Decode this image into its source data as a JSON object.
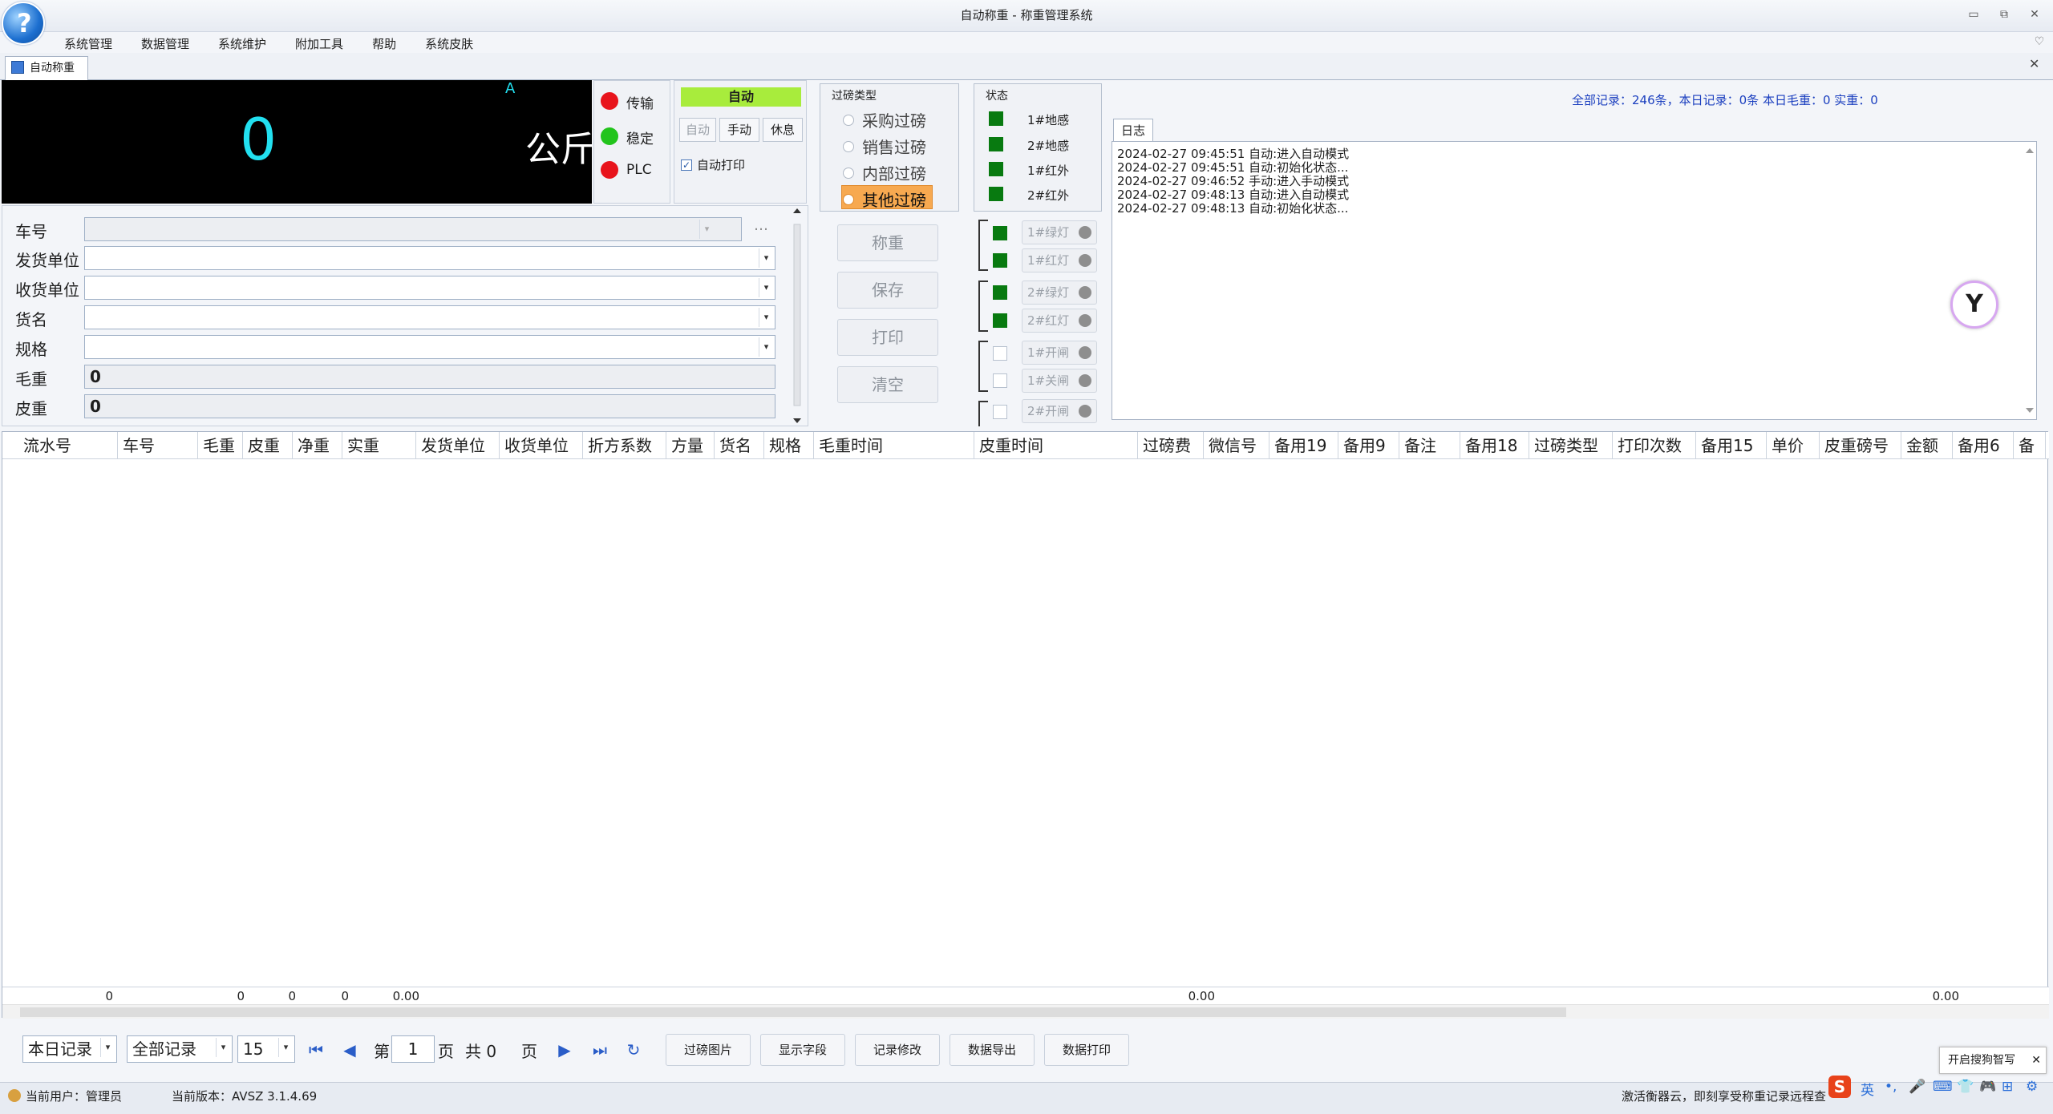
{
  "window": {
    "title": "自动称重 - 称重管理系统",
    "min": "▭",
    "restore": "⧉",
    "close": "✕",
    "collapse": "♡"
  },
  "menu": [
    "系统管理",
    "数据管理",
    "系统维护",
    "附加工具",
    "帮助",
    "系统皮肤"
  ],
  "tab": {
    "label": "自动称重",
    "close": "✕"
  },
  "display": {
    "weight": "0",
    "unit": "公斤",
    "mark": "A"
  },
  "lights": [
    {
      "label": "传输",
      "color": "#e8141c"
    },
    {
      "label": "稳定",
      "color": "#22c41c"
    },
    {
      "label": "PLC",
      "color": "#e8141c"
    }
  ],
  "mode": {
    "badge": "自动",
    "buttons": [
      "自动",
      "手动",
      "休息"
    ],
    "autoprint": "自动打印",
    "check": "✓"
  },
  "form": {
    "labels": [
      "车号",
      "发货单位",
      "收货单位",
      "货名",
      "规格",
      "毛重",
      "皮重"
    ],
    "gross": "0",
    "tare": "0",
    "ellipsis": "…",
    "arrow": "▾"
  },
  "filter": {
    "title": "过磅类型",
    "options": [
      "采购过磅",
      "销售过磅",
      "内部过磅",
      "其他过磅"
    ],
    "selected": "其他过磅"
  },
  "state": {
    "title": "状态",
    "items": [
      "1#地感",
      "2#地感",
      "1#红外",
      "2#红外"
    ]
  },
  "actions": [
    "称重",
    "保存",
    "打印",
    "清空"
  ],
  "controls": [
    "1#绿灯",
    "1#红灯",
    "2#绿灯",
    "2#红灯",
    "1#开闸",
    "1#关闸",
    "2#开闸"
  ],
  "log": {
    "stats": "全部记录：246条，本日记录：0条 本日毛重：0 实重：0",
    "tab": "日志",
    "lines": [
      "2024-02-27 09:45:51 自动:进入自动模式",
      "2024-02-27 09:45:51 自动:初始化状态...",
      "2024-02-27 09:46:52 手动:进入手动模式",
      "2024-02-27 09:48:13 自动:进入自动模式",
      "2024-02-27 09:48:13 自动:初始化状态..."
    ]
  },
  "grid": {
    "columns": [
      "流水号",
      "车号",
      "毛重",
      "皮重",
      "净重",
      "实重",
      "发货单位",
      "收货单位",
      "折方系数",
      "方量",
      "货名",
      "规格",
      "毛重时间",
      "皮重时间",
      "过磅费",
      "微信号",
      "备用19",
      "备用9",
      "备注",
      "备用18",
      "过磅类型",
      "打印次数",
      "备用15",
      "单价",
      "皮重磅号",
      "金额",
      "备用6",
      "备"
    ],
    "footer": [
      "0",
      "0",
      "0",
      "0",
      "0.00",
      "0.00",
      "0.00"
    ]
  },
  "pager": {
    "range": "本日记录",
    "filter": "全部记录",
    "size": "15",
    "page_prefix": "第",
    "page": "1",
    "page_suffix": "页",
    "total": "共 0",
    "total_suffix": "页",
    "buttons": [
      "过磅图片",
      "显示字段",
      "记录修改",
      "数据导出",
      "数据打印"
    ]
  },
  "status": {
    "user": "当前用户：管理员",
    "version": "当前版本：AVSZ 3.1.4.69",
    "ad": "激活衡器云，即刻享受称重记录远程查",
    "tooltip": "开启搜狗智写",
    "tray": [
      "英",
      "•,",
      "🎤",
      "⌨",
      "👕",
      "🎮",
      "⊞",
      "⚙"
    ]
  }
}
